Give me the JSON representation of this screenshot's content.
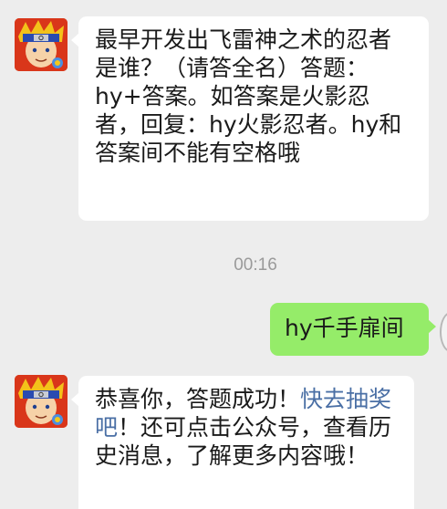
{
  "messages": [
    {
      "sender": "bot",
      "text": "最早开发出飞雷神之术的忍者是谁？（请答全名）答题：hy+答案。如答案是火影忍者，回复：hy火影忍者。hy和答案间不能有空格哦"
    },
    {
      "sender": "user",
      "text": "hy千手扉间"
    },
    {
      "sender": "bot",
      "text_before": "恭喜你，答题成功！",
      "link_text": "快去抽奖吧",
      "text_after": "！还可点击公众号，查看历史消息，了解更多内容哦！"
    }
  ],
  "timestamp": "00:16",
  "colors": {
    "chat_background": "#ededed",
    "incoming_bubble": "#ffffff",
    "outgoing_bubble": "#95ec69",
    "link": "#4a6fa5",
    "timestamp": "#9a9a9a"
  },
  "icons": {
    "bot_avatar": "ninja-avatar-icon",
    "user_avatar": "user-avatar-partial"
  }
}
